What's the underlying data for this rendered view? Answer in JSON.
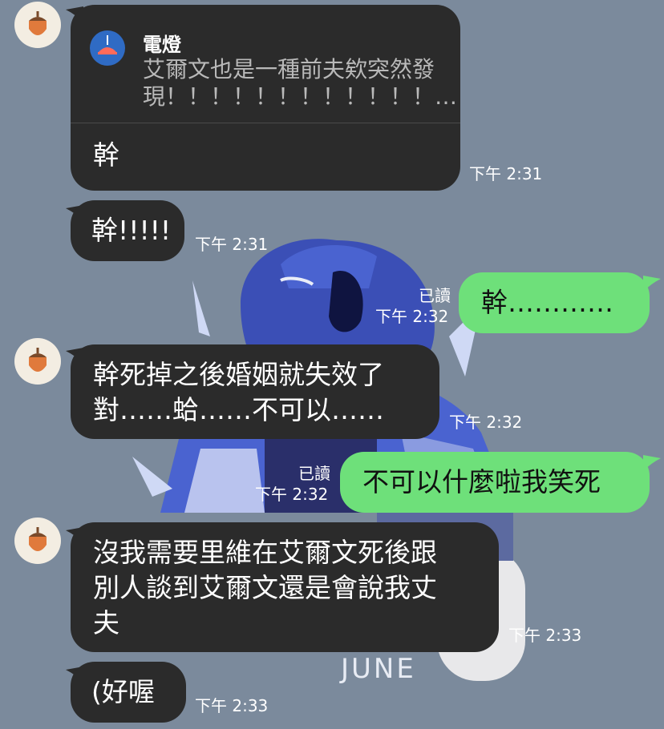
{
  "watermark": "JUNE",
  "messages": [
    {
      "side": "in",
      "reply": {
        "sender": "電燈",
        "text": "艾爾文也是一種前夫欸突然發現！！！！！！！！！！！！…"
      },
      "text": "幹",
      "time": "下午 2:31"
    },
    {
      "side": "in",
      "text": "幹!!!!!",
      "time": "下午 2:31"
    },
    {
      "side": "out",
      "text": "幹…………",
      "read": "已讀",
      "time": "下午 2:32"
    },
    {
      "side": "in",
      "text": "幹死掉之後婚姻就失效了\n對……蛤……不可以……",
      "time": "下午 2:32"
    },
    {
      "side": "out",
      "text": "不可以什麼啦我笑死",
      "read": "已讀",
      "time": "下午 2:32"
    },
    {
      "side": "in",
      "text": "沒我需要里維在艾爾文死後跟\n別人談到艾爾文還是會說我丈\n夫",
      "time": "下午 2:33"
    },
    {
      "side": "in",
      "text": "(好喔",
      "time": "下午 2:33"
    }
  ],
  "colors": {
    "background": "#7b8a9c",
    "incoming_bubble": "#2b2b2b",
    "outgoing_bubble": "#6ee07a"
  },
  "icons": {
    "avatar": "acorn-icon",
    "reply_avatar": "lamp-icon"
  }
}
